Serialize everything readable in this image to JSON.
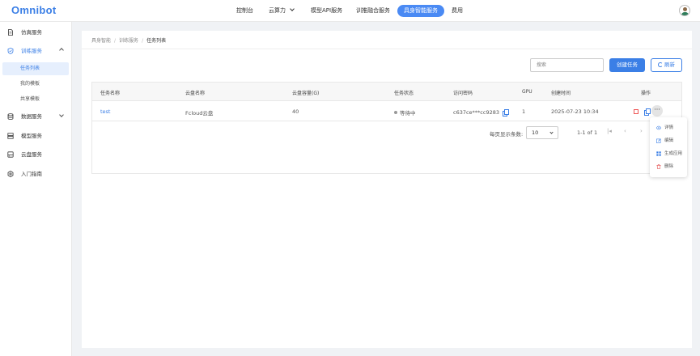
{
  "app": {
    "logo": "Omnibot"
  },
  "topnav": [
    {
      "label": "控制台"
    },
    {
      "label": "云算力"
    },
    {
      "label": "模型API服务"
    },
    {
      "label": "训推融合服务"
    },
    {
      "label": "具身智能服务"
    },
    {
      "label": "费用"
    }
  ],
  "sidebar": {
    "items": [
      {
        "label": "仿真服务",
        "icon": "document-icon"
      },
      {
        "label": "训练服务",
        "icon": "shield-icon"
      },
      {
        "label": "数据服务",
        "icon": "database-icon"
      },
      {
        "label": "模型服务",
        "icon": "server-icon"
      },
      {
        "label": "云盘服务",
        "icon": "cloud-drive-icon"
      },
      {
        "label": "入门指南",
        "icon": "gear-icon"
      }
    ],
    "sub_items": [
      {
        "label": "任务列表"
      },
      {
        "label": "我的模板"
      },
      {
        "label": "共享模板"
      }
    ]
  },
  "breadcrumb": [
    "具身智能",
    "训练服务",
    "任务列表"
  ],
  "toolbar": {
    "search_placeholder": "搜索",
    "create_label": "创建任务",
    "refresh_label": "刷新"
  },
  "table": {
    "headers": [
      "任务名称",
      "云盘名称",
      "云盘容量(G)",
      "任务状态",
      "访问密码",
      "GPU",
      "创建时间",
      "操作"
    ],
    "rows": [
      {
        "name": "test",
        "disk": "Fcloud云盘",
        "capacity": "40",
        "status": "等待中",
        "password": "c637ce***cc9283",
        "gpu": "1",
        "created": "2025-07-23 10:34"
      }
    ]
  },
  "pagination": {
    "per_page_label": "每页显示条数:",
    "per_page": "10",
    "range": "1-1 of 1",
    "first": "|◂",
    "prev": "‹",
    "next": "›"
  },
  "dropdown": [
    {
      "label": "详情",
      "icon": "eye-icon"
    },
    {
      "label": "编辑",
      "icon": "edit-icon"
    },
    {
      "label": "生成应用",
      "icon": "grid-icon"
    },
    {
      "label": "删除",
      "icon": "trash-icon"
    }
  ],
  "colors": {
    "accent": "#3b7fe6",
    "active_nav": "#4a8af4",
    "danger": "#e55555"
  }
}
